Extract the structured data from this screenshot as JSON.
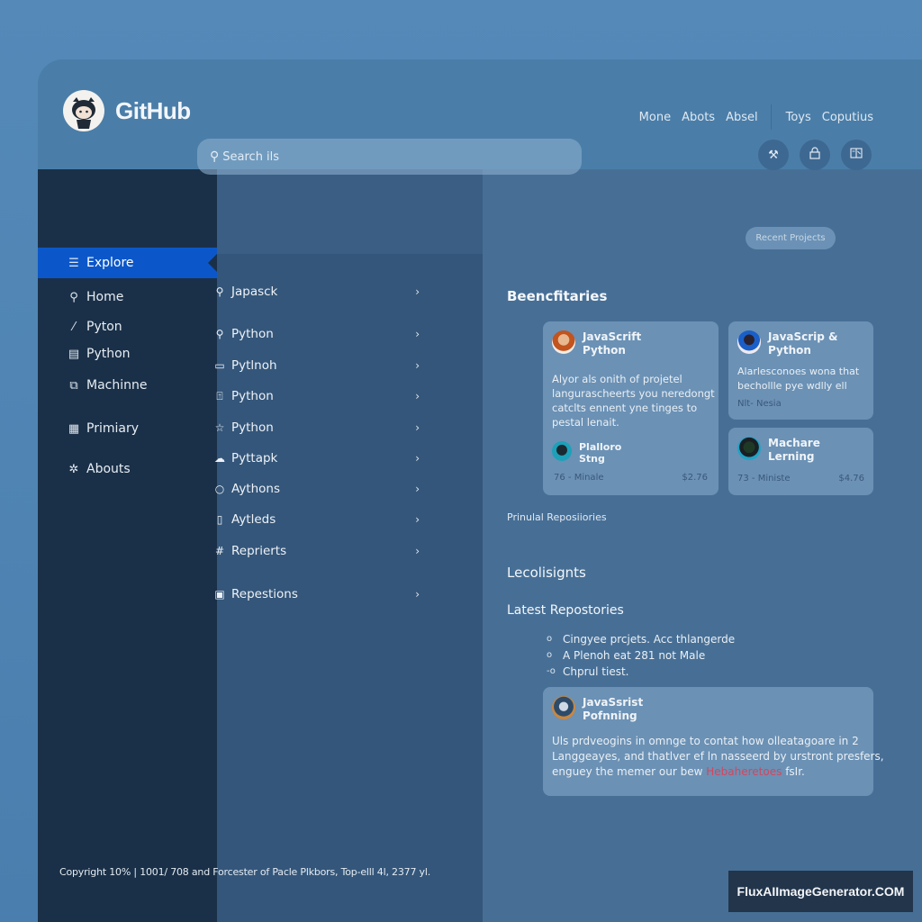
{
  "header": {
    "brand": "GitHub",
    "nav": [
      "Mone",
      "Abots",
      "Absel",
      "Toys",
      "Coputius"
    ]
  },
  "sidebar": {
    "items": [
      {
        "label": "Explore",
        "icon": "list-icon",
        "active": true
      },
      {
        "label": "Home",
        "icon": "search-icon"
      },
      {
        "label": "Pyton",
        "icon": "pen-icon"
      },
      {
        "label": "Python",
        "icon": "document-icon"
      },
      {
        "label": "Machinne",
        "icon": "external-link-icon"
      },
      {
        "label": "Primiary",
        "icon": "grid-icon"
      },
      {
        "label": "Abouts",
        "icon": "gear-icon"
      }
    ]
  },
  "search": {
    "placeholder": "Search ils"
  },
  "toolbar_icons": [
    "tools-icon",
    "lock-icon",
    "book-icon"
  ],
  "middle_list": {
    "items": [
      {
        "label": "Japasck",
        "icon": "search-icon"
      },
      {
        "label": "Python",
        "icon": "search-icon"
      },
      {
        "label": "Pytlnoh",
        "icon": "window-icon"
      },
      {
        "label": "Python",
        "icon": "upload-icon"
      },
      {
        "label": "Python",
        "icon": "star-icon"
      },
      {
        "label": "Pyttapk",
        "icon": "cloud-icon"
      },
      {
        "label": "Aythons",
        "icon": "circle-icon"
      },
      {
        "label": "Aytleds",
        "icon": "panel-icon"
      },
      {
        "label": "Reprierts",
        "icon": "hash-icon"
      },
      {
        "label": "Repestions",
        "icon": "note-icon"
      }
    ],
    "chevron": "›"
  },
  "main": {
    "section_title": "Beencfitaries",
    "recent_button": "Recent Projects",
    "cards": [
      {
        "title_line1": "JavaScrift",
        "title_line2": "Python",
        "description": [
          "Alyor als onith of projetel",
          "langurascheerts you neredongt",
          "catclts ennent yne tinges to",
          "pestal lenait."
        ],
        "sub_title_line1": "Plalloro",
        "sub_title_line2": "Stng",
        "meta_left": "76 - Minale",
        "meta_right": "$2.76"
      },
      {
        "title_line1": "JavaScrip &",
        "title_line2": "Python",
        "description": [
          "Alarlesconoes wona that",
          "bechollle pye wdlly ell"
        ],
        "meta_left": "Nlt- Nesia"
      },
      {
        "title_line1": "Machare",
        "title_line2": "Lerning",
        "meta_left": "73 - Ministe",
        "meta_right": "$4.76"
      }
    ],
    "primary_link": "Prinulal Reposiiories",
    "insights_title": "Lecolisignts",
    "latest_title": "Latest Repostories",
    "latest_items": [
      "Cingyee prcjets. Acc thlangerde",
      "A Plenoh eat 281 not Male",
      "Chprul tiest."
    ],
    "feature_card": {
      "title_line1": "JavaSsrist",
      "title_line2": "Pofnning",
      "line1": "Uls prdveogins in omnge to contat how olleatagoare in 2",
      "line2": "Langgeayes, and thatlver ef ln nasseerd by urstront presfers,",
      "line3_prefix": "enguey the memer our bew",
      "line3_highlight": "Hebaheretoes",
      "line3_suffix": "fsIr.",
      "highlight_color": "#d2475f"
    }
  },
  "footer": {
    "copyright": "Copyright 10% | 1001/ 708 and Forcester of Pacle Plkbors, Top-elll 4l, 2377 yl."
  },
  "watermark": "FluxAIImageGenerator.COM",
  "colors": {
    "accent": "#0b57c9",
    "sidebar_bg": "#1a3048",
    "middle_bg": "#34567a",
    "right_bg": "#476f96",
    "card_bg": "#6b91b5"
  }
}
